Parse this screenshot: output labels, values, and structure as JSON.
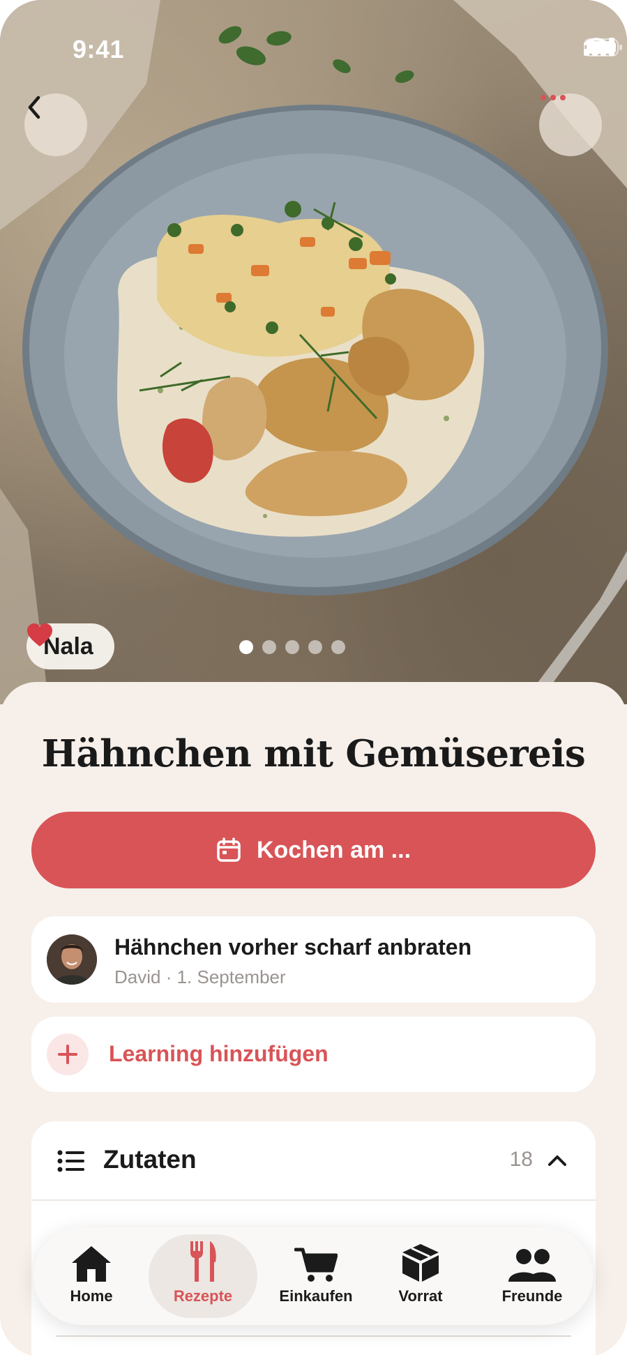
{
  "status_bar": {
    "time": "9:41"
  },
  "colors": {
    "accent": "#d85457",
    "sheet_bg": "#f6efea",
    "card_bg": "#ffffff"
  },
  "hero": {
    "back_icon": "chevron-left-icon",
    "more_icon": "ellipsis-icon",
    "like_chip": {
      "icon": "heart-icon",
      "label": "Nala"
    },
    "pager": {
      "count": 5,
      "active_index": 0
    }
  },
  "recipe": {
    "title": "Hähnchen mit Gemüsereis",
    "cook_button_label": "Kochen am ..."
  },
  "learning": {
    "title": "Hähnchen vorher scharf anbraten",
    "meta": "David · 1. September"
  },
  "add_learning": {
    "label": "Learning hinzufügen"
  },
  "ingredients": {
    "title": "Zutaten",
    "count": "18"
  },
  "tabbar": {
    "tabs": [
      {
        "label": "Home",
        "icon": "house-icon"
      },
      {
        "label": "Rezepte",
        "icon": "fork-knife-icon"
      },
      {
        "label": "Einkaufen",
        "icon": "cart-icon"
      },
      {
        "label": "Vorrat",
        "icon": "box-icon"
      },
      {
        "label": "Freunde",
        "icon": "people-icon"
      }
    ],
    "active_index": 1
  }
}
